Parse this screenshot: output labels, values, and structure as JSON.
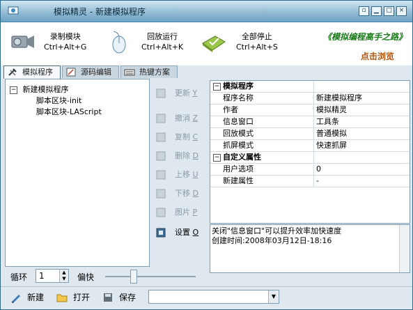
{
  "window": {
    "title": "模拟精灵 - 新建模拟程序",
    "controls": [
      "restore",
      "minimize",
      "maximize",
      "close"
    ]
  },
  "toolbar": {
    "record": {
      "label": "录制模块",
      "shortcut": "Ctrl+Alt+G",
      "icon": "camcorder-icon"
    },
    "replay": {
      "label": "回放运行",
      "shortcut": "Ctrl+Alt+K",
      "icon": "mouse-icon"
    },
    "stop": {
      "label": "全部停止",
      "shortcut": "Ctrl+Alt+S",
      "icon": "folder-check-icon"
    },
    "banner": {
      "title": "《模拟编程高手之路》",
      "link": "点击浏览"
    }
  },
  "tabs": [
    {
      "label": "模拟程序",
      "icon": "tools-icon",
      "active": true
    },
    {
      "label": "源码编辑",
      "icon": "edit-icon",
      "active": false
    },
    {
      "label": "热键方案",
      "icon": "keyboard-icon",
      "active": false
    }
  ],
  "tree": {
    "root": "新建模拟程序",
    "children": [
      "脚本区块-init",
      "脚本区块-LAScript"
    ]
  },
  "actions": [
    {
      "label": "更新",
      "hotkey": "Y",
      "enabled": false
    },
    {
      "label": "撤消",
      "hotkey": "Z",
      "enabled": false
    },
    {
      "label": "复制",
      "hotkey": "C",
      "enabled": false
    },
    {
      "label": "删除",
      "hotkey": "D",
      "enabled": false
    },
    {
      "label": "上移",
      "hotkey": "U",
      "enabled": false
    },
    {
      "label": "下移",
      "hotkey": "D",
      "enabled": false
    },
    {
      "label": "图片",
      "hotkey": "P",
      "enabled": false
    },
    {
      "label": "设置",
      "hotkey": "O",
      "enabled": true
    }
  ],
  "properties": {
    "cat1": "模拟程序",
    "rows1": [
      {
        "key": "程序名称",
        "value": "新建模拟程序"
      },
      {
        "key": "作者",
        "value": "模拟精灵"
      },
      {
        "key": "信息窗口",
        "value": "工具条"
      },
      {
        "key": "回放模式",
        "value": "普通模拟"
      },
      {
        "key": "抓屏模式",
        "value": "快速抓屏"
      }
    ],
    "cat2": "自定义属性",
    "rows2": [
      {
        "key": "用户选项",
        "value": "0"
      },
      {
        "key": "新建属性",
        "value": "-"
      }
    ]
  },
  "info": {
    "line1": "关闭\"信息窗口\"可以提升效率加快速度",
    "line2": "创建时间:2008年03月12日-18:16"
  },
  "loop": {
    "label": "循环",
    "value": "1",
    "speed_label": "偏快",
    "speed_level": 0.3
  },
  "bottom": {
    "new_label": "新建",
    "open_label": "打开",
    "save_label": "保存",
    "combo_value": ""
  }
}
